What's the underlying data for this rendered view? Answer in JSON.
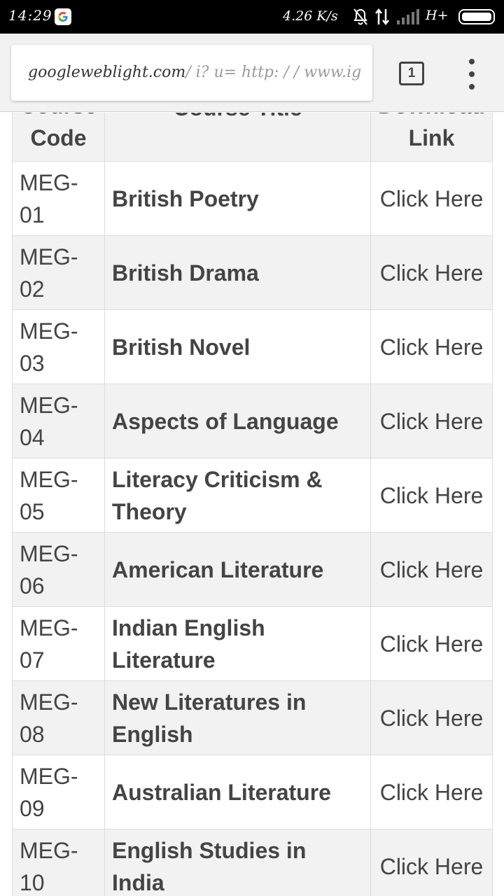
{
  "status_bar": {
    "time": "14:29",
    "speed": "4.26 K/s",
    "network": "H+",
    "icons": [
      "google-app-icon",
      "bell-muted-icon",
      "data-arrows-icon",
      "signal-icon",
      "battery-icon"
    ]
  },
  "browser": {
    "url_host": "googleweblight.com",
    "url_path": "/ i? u= http: / / www.ig",
    "tab_count": "1"
  },
  "table": {
    "headers": {
      "code": "Course Code",
      "title": "Course Title",
      "link": "Download Link"
    },
    "rows": [
      {
        "code": "MEG-01",
        "title": "British Poetry",
        "link": "Click Here"
      },
      {
        "code": "MEG-02",
        "title": "British Drama",
        "link": "Click Here"
      },
      {
        "code": "MEG-03",
        "title": "British Novel",
        "link": "Click Here"
      },
      {
        "code": "MEG-04",
        "title": "Aspects of Language",
        "link": "Click Here"
      },
      {
        "code": "MEG-05",
        "title": "Literacy Criticism & Theory",
        "link": "Click Here"
      },
      {
        "code": "MEG-06",
        "title": "American Literature",
        "link": "Click Here"
      },
      {
        "code": "MEG-07",
        "title": "Indian English Literature",
        "link": "Click Here"
      },
      {
        "code": "MEG-08",
        "title": "New Literatures in English",
        "link": "Click Here"
      },
      {
        "code": "MEG-09",
        "title": "Australian Literature",
        "link": "Click Here"
      },
      {
        "code": "MEG-10",
        "title": "English Studies in India",
        "link": "Click Here"
      }
    ]
  },
  "colors": {
    "link": "#ef776d",
    "text": "#444444",
    "stripe": "#f2f2f2",
    "border": "#dddddd"
  }
}
